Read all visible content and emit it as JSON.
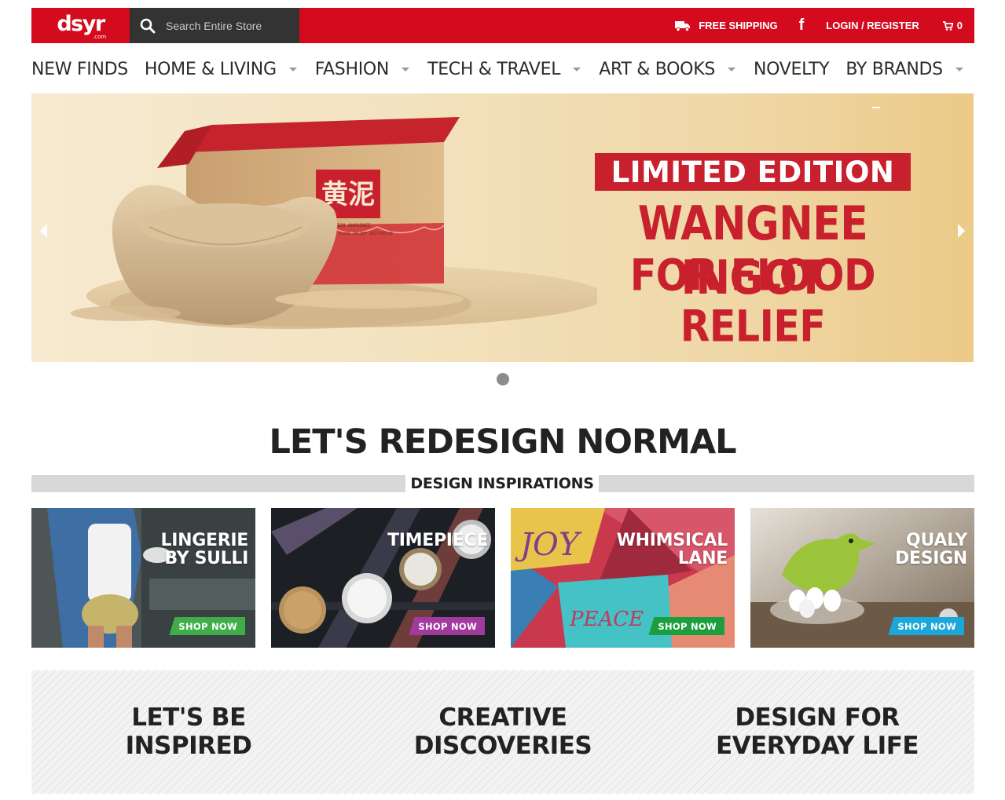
{
  "header": {
    "logo_text": "dsyr",
    "logo_sub": ".com",
    "search_placeholder": "Search Entire Store",
    "free_shipping": "FREE SHIPPING",
    "facebook_glyph": "f",
    "login": "LOGIN / REGISTER",
    "cart_count": "0",
    "brand_color": "#d40a1e"
  },
  "nav": {
    "items": [
      {
        "label": "NEW FINDS",
        "dropdown": false
      },
      {
        "label": "HOME & LIVING",
        "dropdown": true
      },
      {
        "label": "FASHION",
        "dropdown": true
      },
      {
        "label": "TECH & TRAVEL",
        "dropdown": true
      },
      {
        "label": "ART & BOOKS",
        "dropdown": true
      },
      {
        "label": "NOVELTY",
        "dropdown": false
      },
      {
        "label": "BY BRANDS",
        "dropdown": true
      }
    ]
  },
  "hero": {
    "line1": "LIMITED EDITION",
    "line2": "WANGNEE INGOT",
    "line3": "FOR FLOOD RELIEF",
    "box_chinese": "黄泥",
    "box_sub": "MISSION #WANGNEE",
    "box_tag": "A NAGA DOB CHY FLOOD RELIEF INITIATIVE",
    "accent": "#c9202d"
  },
  "section": {
    "headline": "LET'S REDESIGN NORMAL",
    "subheadline": "DESIGN INSPIRATIONS"
  },
  "tiles": [
    {
      "title": "LINGERIE\nBY SULLI",
      "button": "SHOP NOW",
      "button_color": "#3fae49"
    },
    {
      "title": "TIMEPIECE",
      "button": "SHOP NOW",
      "button_color": "#a23a9e"
    },
    {
      "title": "WHIMSICAL\nLANE",
      "button": "SHOP NOW",
      "button_color": "#1b9f3e"
    },
    {
      "title": "QUALY\nDESIGN",
      "button": "SHOP NOW",
      "button_color": "#1ba7d9"
    }
  ],
  "band": {
    "columns": [
      "LET'S BE\nINSPIRED",
      "CREATIVE\nDISCOVERIES",
      "DESIGN FOR\nEVERYDAY LIFE"
    ]
  }
}
